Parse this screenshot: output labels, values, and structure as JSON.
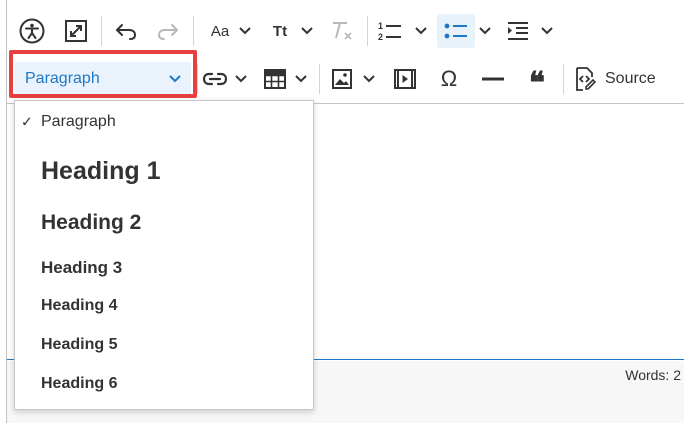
{
  "toolbar": {
    "row1": {
      "accessibility": "accessibility-icon",
      "fullscreen": "fullscreen-icon",
      "undo": "undo-icon",
      "redo": "redo-icon",
      "font_size_label": "Aa",
      "text_style_label": "Tt",
      "clear_format": "clear-formatting-icon",
      "numbered_list": "numbered-list-icon",
      "bulleted_list": "bulleted-list-icon",
      "indent": "indent-icon"
    },
    "row2": {
      "heading_value": "Paragraph",
      "link": "link-icon",
      "table": "table-icon",
      "image": "image-icon",
      "media": "media-icon",
      "special_char": "Ω",
      "horizontal_line": "horizontal-line-icon",
      "blockquote_label": "❝",
      "source_label": "Source"
    }
  },
  "heading_dropdown": {
    "items": [
      {
        "label": "Paragraph",
        "selected": true
      },
      {
        "label": "Heading 1"
      },
      {
        "label": "Heading 2"
      },
      {
        "label": "Heading 3"
      },
      {
        "label": "Heading 4"
      },
      {
        "label": "Heading 5"
      },
      {
        "label": "Heading 6"
      }
    ],
    "check_glyph": "✓"
  },
  "status": {
    "word_count": "Words: 2"
  },
  "colors": {
    "accent": "#1e78c8",
    "highlight": "#e84040",
    "active_bg": "#e8f2fb"
  }
}
